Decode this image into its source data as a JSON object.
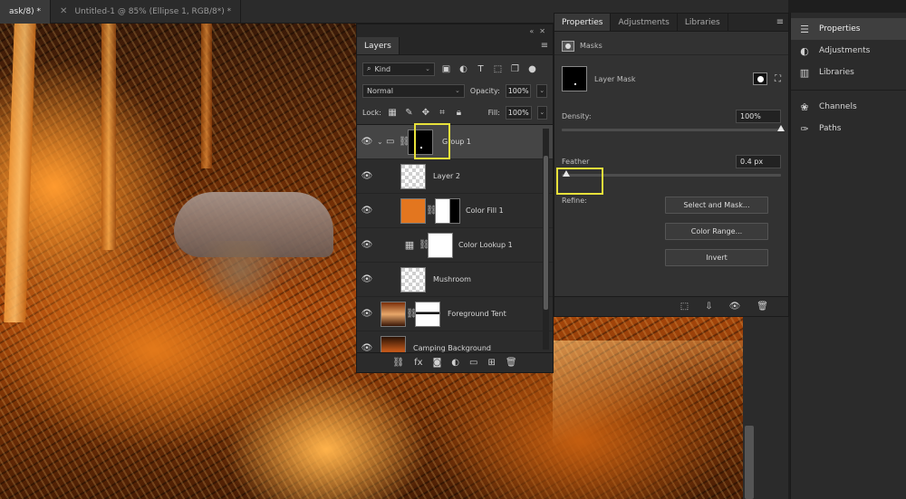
{
  "doc_tabs": [
    {
      "label": "ask/8) *",
      "active": true
    },
    {
      "label": "Untitled-1 @ 85% (Ellipse 1, RGB/8*) *",
      "active": false
    }
  ],
  "layers_panel": {
    "tab": "Layers",
    "filter_kind": "Kind",
    "blend_mode": "Normal",
    "opacity_label": "Opacity:",
    "opacity_value": "100%",
    "lock_label": "Lock:",
    "fill_label": "Fill:",
    "fill_value": "100%",
    "layers": [
      {
        "name": "Group 1",
        "type": "group",
        "selected": true
      },
      {
        "name": "Layer 2",
        "type": "pixel"
      },
      {
        "name": "Color Fill 1",
        "type": "fill",
        "fill_color": "#e3761f"
      },
      {
        "name": "Color Lookup 1",
        "type": "adjustment"
      },
      {
        "name": "Mushroom",
        "type": "pixel"
      },
      {
        "name": "Foreground Tent",
        "type": "pixel-mask"
      },
      {
        "name": "Camping Background",
        "type": "pixel"
      }
    ],
    "footer_icons": [
      "link-icon",
      "fx-icon",
      "mask-icon",
      "adjustment-icon",
      "folder-icon",
      "new-layer-icon",
      "trash-icon"
    ]
  },
  "properties_panel": {
    "tabs": [
      "Properties",
      "Adjustments",
      "Libraries"
    ],
    "active_tab": "Properties",
    "section_title": "Masks",
    "layer_mask_label": "Layer Mask",
    "density_label": "Density:",
    "density_value": "100%",
    "density_level": 1.0,
    "feather_label": "Feather",
    "feather_value": "0.4 px",
    "feather_level": 0.0,
    "refine_label": "Refine:",
    "buttons": {
      "select_and_mask": "Select and Mask...",
      "color_range": "Color Range...",
      "invert": "Invert"
    }
  },
  "dock": {
    "items": [
      {
        "label": "Properties",
        "icon": "sliders-icon",
        "active": true
      },
      {
        "label": "Adjustments",
        "icon": "adjustments-icon",
        "active": false
      },
      {
        "label": "Libraries",
        "icon": "libraries-icon",
        "active": false
      },
      {
        "label": "Channels",
        "icon": "channels-icon",
        "active": false
      },
      {
        "label": "Paths",
        "icon": "paths-icon",
        "active": false
      }
    ]
  },
  "colors": {
    "highlight": "#e8e13a",
    "panel_bg": "#323232",
    "canvas_orange": "#e3761f"
  }
}
